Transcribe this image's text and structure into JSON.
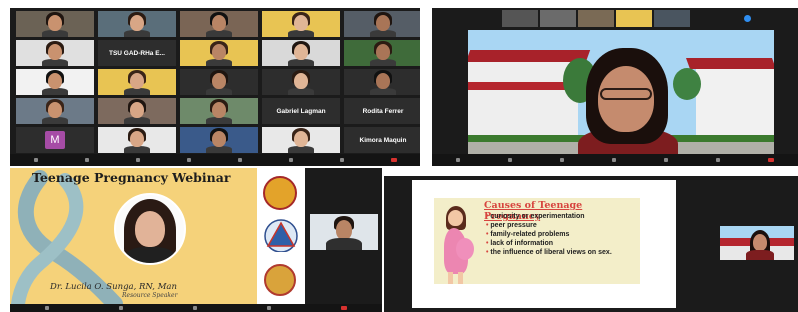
{
  "gallery": {
    "tiles": [
      {
        "name": "",
        "bg": "#6b6255"
      },
      {
        "name": "",
        "bg": "#5a6e7a"
      },
      {
        "name": "",
        "bg": "#7a6555"
      },
      {
        "name": "",
        "bg": "#e8c453"
      },
      {
        "name": "",
        "bg": "#555d66"
      },
      {
        "name": "",
        "bg": "#e0e0e0"
      },
      {
        "name": "TSU GAD-RHa E...",
        "bg": "#2d2d2d",
        "bold": true
      },
      {
        "name": "",
        "bg": "#e8c453"
      },
      {
        "name": "",
        "bg": "#d9d9d9"
      },
      {
        "name": "",
        "bg": "#3f6b3a"
      },
      {
        "name": "",
        "bg": "#f2f2f2"
      },
      {
        "name": "",
        "bg": "#e8c453"
      },
      {
        "name": "",
        "bg": "#2d2d2d"
      },
      {
        "name": "",
        "bg": "#2d2d2d"
      },
      {
        "name": "",
        "bg": "#2d2d2d"
      },
      {
        "name": "",
        "bg": "#6c7a88"
      },
      {
        "name": "",
        "bg": "#7d6a5e"
      },
      {
        "name": "",
        "bg": "#6e8a6a"
      },
      {
        "name": "Gabriel Lagman",
        "bg": "#2d2d2d",
        "bold": true
      },
      {
        "name": "Rodita Ferrer",
        "bg": "#2d2d2d",
        "bold": true
      },
      {
        "name": "M",
        "bg": "#2d2d2d",
        "avatar": true
      },
      {
        "name": "",
        "bg": "#e8e8e8"
      },
      {
        "name": "",
        "bg": "#3a5a8a"
      },
      {
        "name": "",
        "bg": "#e8e8e8"
      },
      {
        "name": "Kimora Maquin",
        "bg": "#2d2d2d",
        "bold": true
      }
    ]
  },
  "speaker_view": {
    "strip_names": [
      "",
      "",
      "",
      "",
      ""
    ]
  },
  "banner": {
    "title": "Teenage Pregnancy Webinar",
    "speaker": "Dr. Lucila O. Sunga, RN, Man",
    "role": "Resource Speaker"
  },
  "slide": {
    "title": "Causes of Teenage Pregnancy",
    "items": [
      "curiosity or experimentation",
      "peer pressure",
      "family-related problems",
      "lack of information",
      "the influence of liberal views on sex."
    ]
  },
  "colors": {
    "zoom_dark": "#1b1b1b",
    "tile_dark": "#2d2d2d",
    "banner_bg": "#f5d27a",
    "slide_box": "#f3eec9",
    "slide_title": "#d7443e",
    "leave_red": "#d8322f",
    "avatar_purple": "#a64ca6"
  },
  "icons": [
    "microphone-icon",
    "video-icon",
    "participants-icon",
    "chat-icon",
    "share-screen-icon",
    "record-icon",
    "reactions-icon",
    "leave-button",
    "pink-ribbon-icon",
    "university-seal-icon",
    "triangle-logo-icon",
    "award-seal-icon"
  ]
}
